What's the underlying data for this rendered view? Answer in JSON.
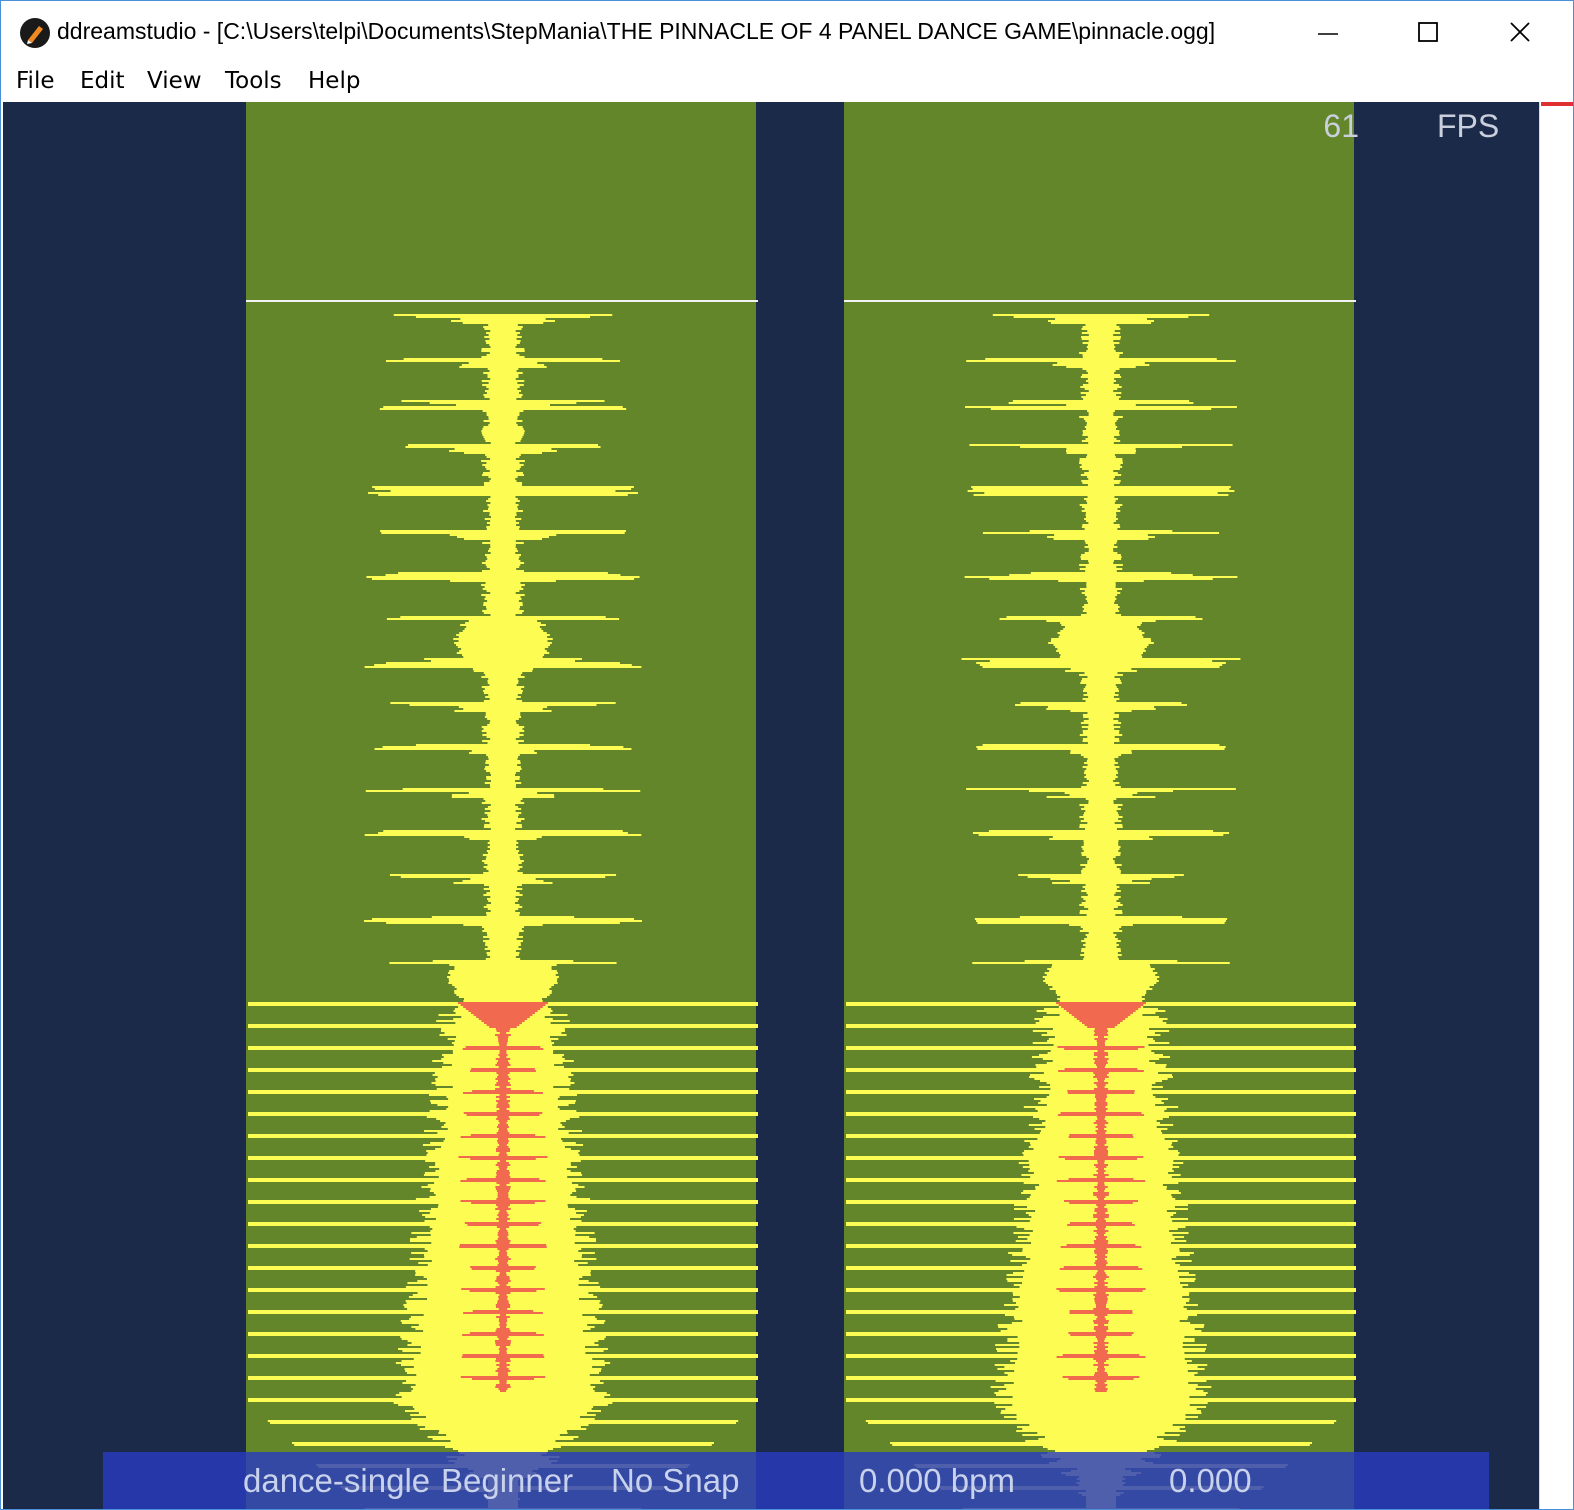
{
  "window": {
    "title": "ddreamstudio - [C:\\Users\\telpi\\Documents\\StepMania\\THE PINNACLE OF 4 PANEL DANCE GAME\\pinnacle.ogg]",
    "controls": {
      "minimize": "minimize-icon",
      "maximize": "maximize-icon",
      "close": "close-icon"
    }
  },
  "menu": {
    "items": [
      {
        "label": "File"
      },
      {
        "label": "Edit"
      },
      {
        "label": "View"
      },
      {
        "label": "Tools"
      },
      {
        "label": "Help"
      }
    ]
  },
  "overlay": {
    "fps_value": "61",
    "fps_label": "FPS"
  },
  "status": {
    "style": "dance-single",
    "difficulty": "Beginner",
    "snap": "No Snap",
    "bpm": "0.000 bpm",
    "time": "0.000"
  },
  "colors": {
    "background": "#1c2a4a",
    "lane": "#63862b",
    "waveform": "#fcfc52",
    "waveform_peak": "#f1694f",
    "receptor_line": "#f2f2f2",
    "statusbar": "#2a3cbe"
  }
}
